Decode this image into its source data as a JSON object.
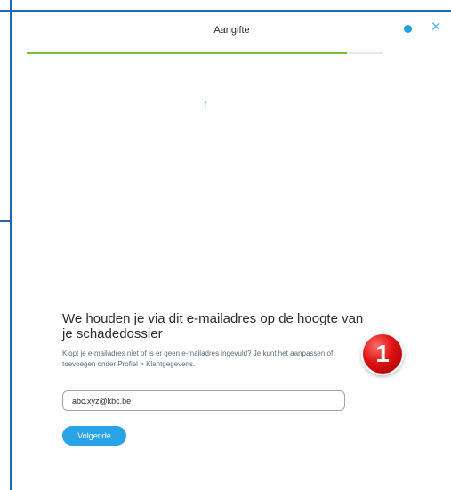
{
  "window": {
    "title": "Aangifte"
  },
  "progress": {
    "value": 0.9
  },
  "content": {
    "heading": "We houden je via dit e-mailadres op de hoogte van je schadedossier",
    "subtext": "Klopt je e-mailadres niet of is er geen e-mailadres ingevuld? Je kunt het aanpassen of toevoegen onder Profiel > Klantgegevens.",
    "badge_number": "1"
  },
  "email_field": {
    "value": "abc.xyz@kbc.be"
  },
  "actions": {
    "next_label": "Volgende"
  },
  "icons": {
    "close": "close-icon",
    "status": "status-dot-icon",
    "arrow": "arrow-up-icon"
  },
  "colors": {
    "frame": "#1f66b0",
    "accent_blue": "#2aa3e6",
    "progress_green": "#7bbf3a",
    "badge_red": "#d11111"
  }
}
